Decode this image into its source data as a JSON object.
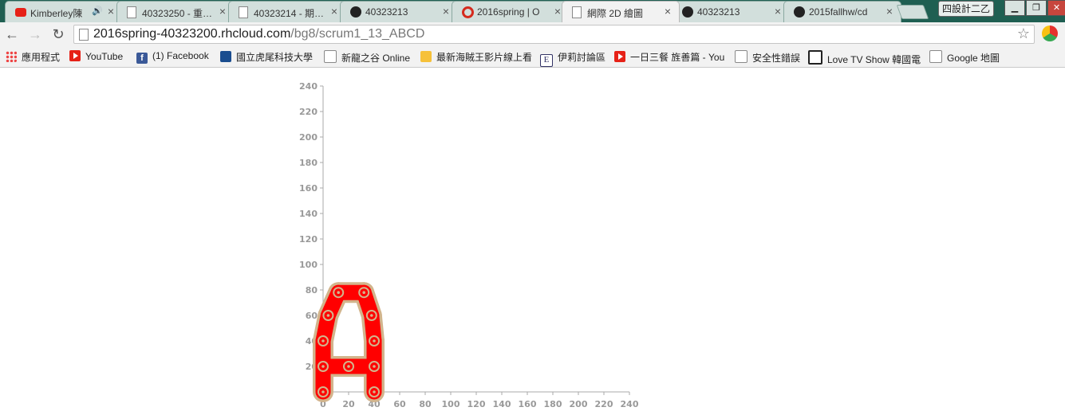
{
  "tabs": [
    {
      "title": "Kimberley陳",
      "icon": "youtube-icon",
      "audio": true
    },
    {
      "title": "40323250 - 重…",
      "icon": "page-icon"
    },
    {
      "title": "40323214 - 期…",
      "icon": "page-icon"
    },
    {
      "title": "40323213",
      "icon": "github-icon"
    },
    {
      "title": "2016spring | O",
      "icon": "openshift-icon"
    },
    {
      "title": "網際 2D 繪圖",
      "icon": "page-icon",
      "active": true
    },
    {
      "title": "40323213",
      "icon": "github-icon"
    },
    {
      "title": "2015fallhw/cd",
      "icon": "github-icon"
    }
  ],
  "window": {
    "profile": "四設計二乙"
  },
  "address_bar": {
    "host": "2016spring-40323200.rhcloud.com",
    "path": "/bg8/scrum1_13_ABCD"
  },
  "bookmarks": [
    {
      "label": "應用程式",
      "icon": "apps-icon"
    },
    {
      "label": "YouTube",
      "icon": "youtube-icon"
    },
    {
      "label": "(1) Facebook",
      "icon": "facebook-icon"
    },
    {
      "label": "國立虎尾科技大學",
      "icon": "eye-icon"
    },
    {
      "label": "新龍之谷 Online",
      "icon": "page-icon"
    },
    {
      "label": "最新海賊王影片線上看",
      "icon": "face-icon"
    },
    {
      "label": "伊莉討論區",
      "icon": "e-icon"
    },
    {
      "label": "一日三餐 旌善篇 - You",
      "icon": "youtube-icon"
    },
    {
      "label": "安全性錯誤",
      "icon": "page-icon"
    },
    {
      "label": "Love TV Show 韓國電",
      "icon": "tv-icon"
    },
    {
      "label": "Google 地圖",
      "icon": "page-icon"
    }
  ],
  "chart_data": {
    "type": "scatter",
    "title": "",
    "xlabel": "",
    "ylabel": "",
    "xlim": [
      0,
      240
    ],
    "ylim": [
      0,
      240
    ],
    "x_ticks": [
      0,
      20,
      40,
      60,
      80,
      100,
      120,
      140,
      160,
      180,
      200,
      220,
      240
    ],
    "y_ticks": [
      20,
      40,
      60,
      80,
      100,
      120,
      140,
      160,
      180,
      200,
      220,
      240
    ],
    "grid": false,
    "colors": {
      "link_fill": "#ff0000",
      "link_outline": "#d2b48c",
      "axis": "#aaaaaa"
    },
    "chain_links": [
      [
        0,
        0,
        0,
        20
      ],
      [
        0,
        20,
        0,
        40
      ],
      [
        0,
        40,
        4,
        60
      ],
      [
        4,
        60,
        12,
        78
      ],
      [
        12,
        78,
        32,
        78
      ],
      [
        32,
        78,
        38,
        60
      ],
      [
        38,
        60,
        40,
        40
      ],
      [
        40,
        40,
        40,
        20
      ],
      [
        40,
        20,
        40,
        0
      ],
      [
        0,
        20,
        20,
        20
      ],
      [
        20,
        20,
        40,
        20
      ]
    ],
    "joints": [
      [
        0,
        0
      ],
      [
        0,
        20
      ],
      [
        0,
        40
      ],
      [
        4,
        60
      ],
      [
        12,
        78
      ],
      [
        32,
        78
      ],
      [
        38,
        60
      ],
      [
        40,
        40
      ],
      [
        40,
        20
      ],
      [
        40,
        0
      ],
      [
        20,
        20
      ]
    ]
  }
}
